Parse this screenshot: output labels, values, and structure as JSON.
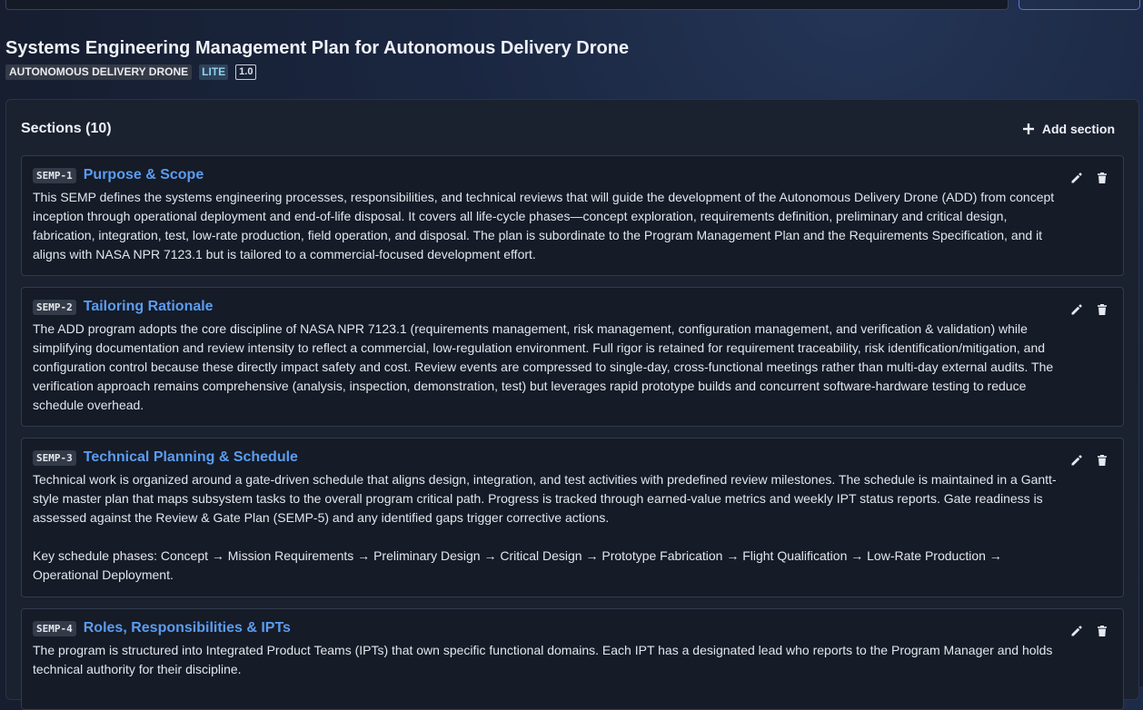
{
  "header": {
    "title": "Systems Engineering Management Plan for Autonomous Delivery Drone",
    "product_tag": "AUTONOMOUS DELIVERY DRONE",
    "level_tag": "LITE",
    "version_tag": "1.0"
  },
  "sections": {
    "heading": "Sections (10)",
    "add_label": "Add section",
    "items": [
      {
        "id": "SEMP-1",
        "title": "Purpose & Scope",
        "paragraphs": [
          "This SEMP defines the systems engineering processes, responsibilities, and technical reviews that will guide the development of the Autonomous Delivery Drone (ADD) from concept inception through operational deployment and end-of-life disposal. It covers all life-cycle phases—concept exploration, requirements definition, preliminary and critical design, fabrication, integration, test, low-rate production, field operation, and disposal. The plan is subordinate to the Program Management Plan and the Requirements Specification, and it aligns with NASA NPR 7123.1 but is tailored to a commercial-focused development effort."
        ]
      },
      {
        "id": "SEMP-2",
        "title": "Tailoring Rationale",
        "paragraphs": [
          "The ADD program adopts the core discipline of NASA NPR 7123.1 (requirements management, risk management, configuration management, and verification & validation) while simplifying documentation and review intensity to reflect a commercial, low-regulation environment. Full rigor is retained for requirement traceability, risk identification/mitigation, and configuration control because these directly impact safety and cost. Review events are compressed to single-day, cross-functional meetings rather than multi-day external audits. The verification approach remains comprehensive (analysis, inspection, demonstration, test) but leverages rapid prototype builds and concurrent software-hardware testing to reduce schedule overhead."
        ]
      },
      {
        "id": "SEMP-3",
        "title": "Technical Planning & Schedule",
        "paragraphs": [
          "Technical work is organized around a gate-driven schedule that aligns design, integration, and test activities with predefined review milestones. The schedule is maintained in a Gantt-style master plan that maps subsystem tasks to the overall program critical path. Progress is tracked through earned-value metrics and weekly IPT status reports. Gate readiness is assessed against the Review & Gate Plan (SEMP-5) and any identified gaps trigger corrective actions.",
          "Key schedule phases: Concept → Mission Requirements → Preliminary Design → Critical Design → Prototype Fabrication → Flight Qualification → Low-Rate Production → Operational Deployment."
        ]
      },
      {
        "id": "SEMP-4",
        "title": "Roles, Responsibilities & IPTs",
        "paragraphs": [
          "The program is structured into Integrated Product Teams (IPTs) that own specific functional domains. Each IPT has a designated lead who reports to the Program Manager and holds technical authority for their discipline."
        ]
      }
    ]
  },
  "icons": {
    "add": "plus-icon",
    "edit": "pencil-icon",
    "delete": "trash-icon"
  },
  "colors": {
    "title_link": "#5b9cf0",
    "lite_tag_text": "#8fd0f2",
    "background": "#161e30"
  }
}
